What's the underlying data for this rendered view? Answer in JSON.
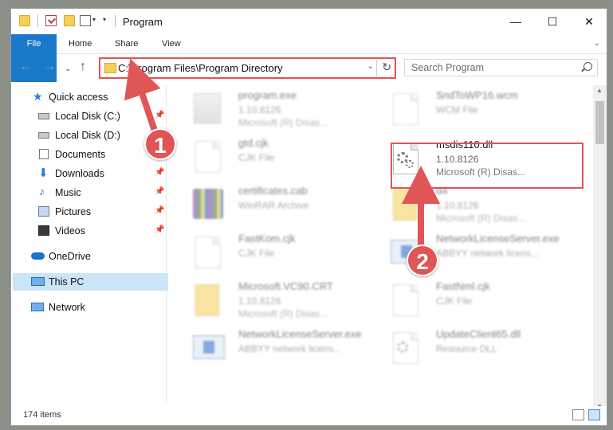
{
  "window": {
    "title": "Program",
    "controls": {
      "minimize": "—",
      "maximize": "☐",
      "close": "✕"
    }
  },
  "ribbon": {
    "tabs": [
      {
        "label": "File"
      },
      {
        "label": "Home"
      },
      {
        "label": "Share"
      },
      {
        "label": "View"
      }
    ],
    "expand_icon": "chevron-down-icon"
  },
  "address": {
    "path": "C:\\Program Files\\Program Directory",
    "search_placeholder": "Search Program"
  },
  "sidebar": {
    "items": [
      {
        "label": "Quick access",
        "icon": "star-icon",
        "pinned": false
      },
      {
        "label": "Local Disk (C:)",
        "icon": "drive-icon",
        "pinned": true
      },
      {
        "label": "Local Disk (D:)",
        "icon": "drive-icon",
        "pinned": false
      },
      {
        "label": "Documents",
        "icon": "documents-icon",
        "pinned": true
      },
      {
        "label": "Downloads",
        "icon": "downloads-icon",
        "pinned": true
      },
      {
        "label": "Music",
        "icon": "music-icon",
        "pinned": true
      },
      {
        "label": "Pictures",
        "icon": "pictures-icon",
        "pinned": true
      },
      {
        "label": "Videos",
        "icon": "videos-icon",
        "pinned": true
      },
      {
        "label": "OneDrive",
        "icon": "cloud-icon",
        "pinned": false
      },
      {
        "label": "This PC",
        "icon": "monitor-icon",
        "pinned": false,
        "selected": true
      },
      {
        "label": "Network",
        "icon": "network-icon",
        "pinned": false
      }
    ]
  },
  "files": [
    {
      "name": "program.exe",
      "line2": "1.10.8126",
      "line3": "Microsoft (R) Disas...",
      "icon": "exe-icon"
    },
    {
      "name": "SndToWP16.wcm",
      "line2": "WCM File",
      "line3": "",
      "icon": "document-icon"
    },
    {
      "name": "gtd.cjk",
      "line2": "CJK File",
      "line3": "",
      "icon": "document-icon"
    },
    {
      "name": "msdis110.dll",
      "line2": "1.10.8126",
      "line3": "Microsoft (R) Disas...",
      "icon": "dll-gear-icon"
    },
    {
      "name": "certificates.cab",
      "line2": "WinRAR Archive",
      "line3": "",
      "icon": "winrar-icon"
    },
    {
      "name": "d4",
      "line2": "1.10.8126",
      "line3": "Microsoft (R) Disas...",
      "icon": "folder-icon"
    },
    {
      "name": "FastKom.cjk",
      "line2": "CJK File",
      "line3": "",
      "icon": "document-icon"
    },
    {
      "name": "NetworkLicenseServer.exe",
      "line2": "ABBYY network licens...",
      "line3": "",
      "icon": "app-window-icon"
    },
    {
      "name": "Microsoft.VC90.CRT",
      "line2": "1.10.8126",
      "line3": "Microsoft (R) Disas...",
      "icon": "folder-icon"
    },
    {
      "name": "FastNml.cjk",
      "line2": "CJK File",
      "line3": "",
      "icon": "document-icon"
    },
    {
      "name": "NetworkLicenseServer.exe",
      "line2": "ABBYY network licens...",
      "line3": "",
      "icon": "app-window-icon"
    },
    {
      "name": "UpdateClient65.dll",
      "line2": "Resource DLL",
      "line3": "",
      "icon": "dll-gear-icon"
    }
  ],
  "status": {
    "count": "174 items"
  },
  "callouts": [
    "1",
    "2"
  ],
  "colors": {
    "accent": "#1979ca",
    "highlight": "#e35252",
    "selection": "#cce4f7"
  }
}
